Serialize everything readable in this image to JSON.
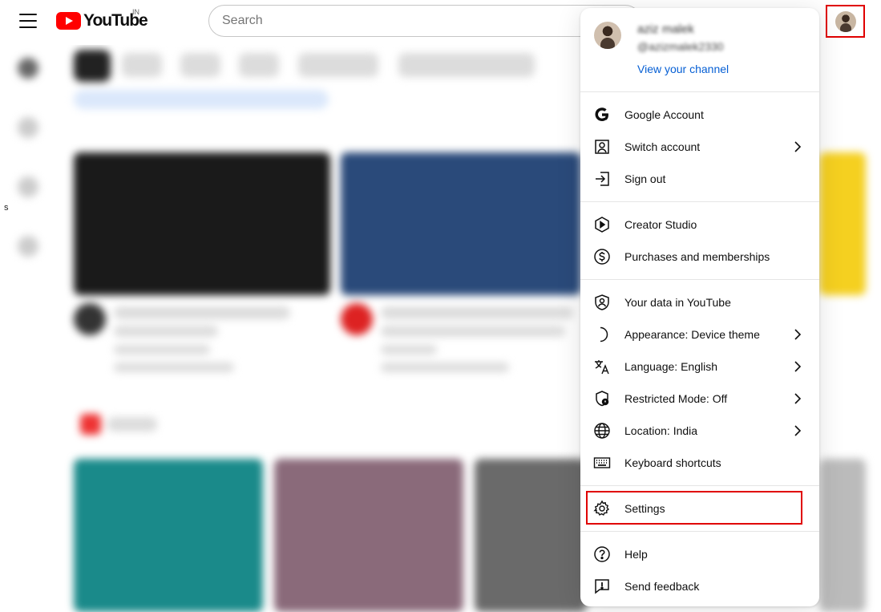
{
  "header": {
    "logo_text": "YouTube",
    "country_code": "IN",
    "search_placeholder": "Search"
  },
  "sidebar": {
    "partial_letter": "s"
  },
  "menu": {
    "profile": {
      "name": "aziz malek",
      "handle": "@azizmalek2330",
      "view_channel": "View your channel"
    },
    "sections": [
      {
        "items": [
          {
            "label": "Google Account",
            "icon": "google-icon",
            "chevron": false
          },
          {
            "label": "Switch account",
            "icon": "switch-account-icon",
            "chevron": true
          },
          {
            "label": "Sign out",
            "icon": "sign-out-icon",
            "chevron": false
          }
        ]
      },
      {
        "items": [
          {
            "label": "Creator Studio",
            "icon": "creator-studio-icon",
            "chevron": false
          },
          {
            "label": "Purchases and memberships",
            "icon": "purchases-icon",
            "chevron": false
          }
        ]
      },
      {
        "items": [
          {
            "label": "Your data in YouTube",
            "icon": "your-data-icon",
            "chevron": false
          },
          {
            "label": "Appearance: Device theme",
            "icon": "appearance-icon",
            "chevron": true
          },
          {
            "label": "Language: English",
            "icon": "language-icon",
            "chevron": true
          },
          {
            "label": "Restricted Mode: Off",
            "icon": "restricted-mode-icon",
            "chevron": true
          },
          {
            "label": "Location: India",
            "icon": "globe-icon",
            "chevron": true
          },
          {
            "label": "Keyboard shortcuts",
            "icon": "keyboard-icon",
            "chevron": false
          }
        ]
      },
      {
        "items": [
          {
            "label": "Settings",
            "icon": "gear-icon",
            "chevron": false
          }
        ]
      },
      {
        "items": [
          {
            "label": "Help",
            "icon": "help-icon",
            "chevron": false
          },
          {
            "label": "Send feedback",
            "icon": "feedback-icon",
            "chevron": false
          }
        ]
      }
    ]
  },
  "colors": {
    "brand_red": "#ff0000",
    "link_blue": "#065fd4",
    "highlight_red": "#e00000"
  }
}
